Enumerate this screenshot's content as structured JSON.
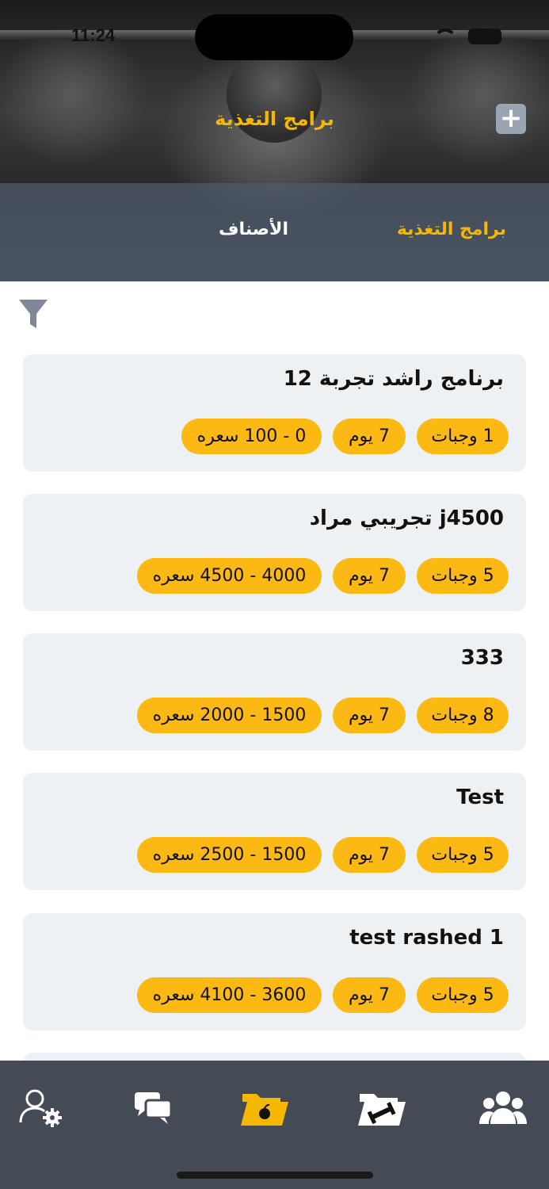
{
  "status_bar": {
    "time": "11:24"
  },
  "header": {
    "title": "برامج التغذية",
    "add_button_label": "+"
  },
  "tabs": [
    {
      "label": "برامج التغذية",
      "active": true
    },
    {
      "label": "الأصناف",
      "active": false
    }
  ],
  "filter": {
    "icon": "filter-icon"
  },
  "programs": [
    {
      "name": "برنامج راشد تجربة 12",
      "meals": "1 وجبات",
      "days": "7 يوم",
      "calories": "0 - 100 سعره"
    },
    {
      "name": "j4500 تجريبي مراد",
      "meals": "5 وجبات",
      "days": "7 يوم",
      "calories": "4000 - 4500 سعره"
    },
    {
      "name": "333",
      "meals": "8 وجبات",
      "days": "7 يوم",
      "calories": "1500 - 2000 سعره"
    },
    {
      "name": "Test",
      "meals": "5 وجبات",
      "days": "7 يوم",
      "calories": "1500 - 2500 سعره"
    },
    {
      "name": "test rashed 1",
      "meals": "5 وجبات",
      "days": "7 يوم",
      "calories": "3600 - 4100 سعره"
    }
  ],
  "bottom_nav": {
    "items": [
      {
        "icon": "user-settings-icon",
        "active": false
      },
      {
        "icon": "chat-icon",
        "active": false
      },
      {
        "icon": "nutrition-folder-icon",
        "active": true
      },
      {
        "icon": "workout-folder-icon",
        "active": false
      },
      {
        "icon": "users-group-icon",
        "active": false
      }
    ]
  },
  "colors": {
    "accent": "#f5b800",
    "chip": "#fcb813",
    "card_bg": "#eef1f4",
    "nav_bg": "#454b55",
    "tab_strip": "#505c6e"
  }
}
